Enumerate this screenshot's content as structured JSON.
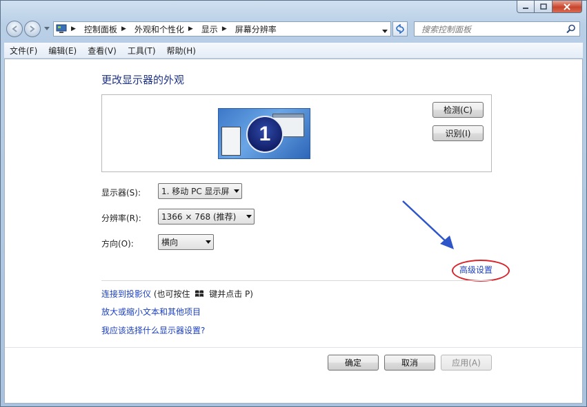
{
  "address_bar": {
    "crumbs": [
      "控制面板",
      "外观和个性化",
      "显示",
      "屏幕分辨率"
    ]
  },
  "search": {
    "placeholder": "搜索控制面板"
  },
  "menu": [
    "文件(F)",
    "编辑(E)",
    "查看(V)",
    "工具(T)",
    "帮助(H)"
  ],
  "page": {
    "title": "更改显示器的外观",
    "monitor_number": "1",
    "detect_label": "检测(C)",
    "identify_label": "识别(I)"
  },
  "form": {
    "display_label": "显示器(S):",
    "display_value": "1. 移动 PC 显示屏",
    "resolution_label": "分辨率(R):",
    "resolution_value": "1366 × 768 (推荐)",
    "orientation_label": "方向(O):",
    "orientation_value": "横向"
  },
  "advanced_link": "高级设置",
  "links": {
    "projector": "连接到投影仪",
    "projector_hint_pre": "(也可按住",
    "projector_hint_post": "键并点击 P)",
    "text_size": "放大或缩小文本和其他项目",
    "which_settings": "我应该选择什么显示器设置?"
  },
  "buttons": {
    "ok": "确定",
    "cancel": "取消",
    "apply": "应用(A)"
  },
  "colors": {
    "link": "#1b3fbf",
    "title": "#1e3287",
    "highlight_ellipse": "#d9232a",
    "annotation_arrow": "#2f56c8"
  }
}
